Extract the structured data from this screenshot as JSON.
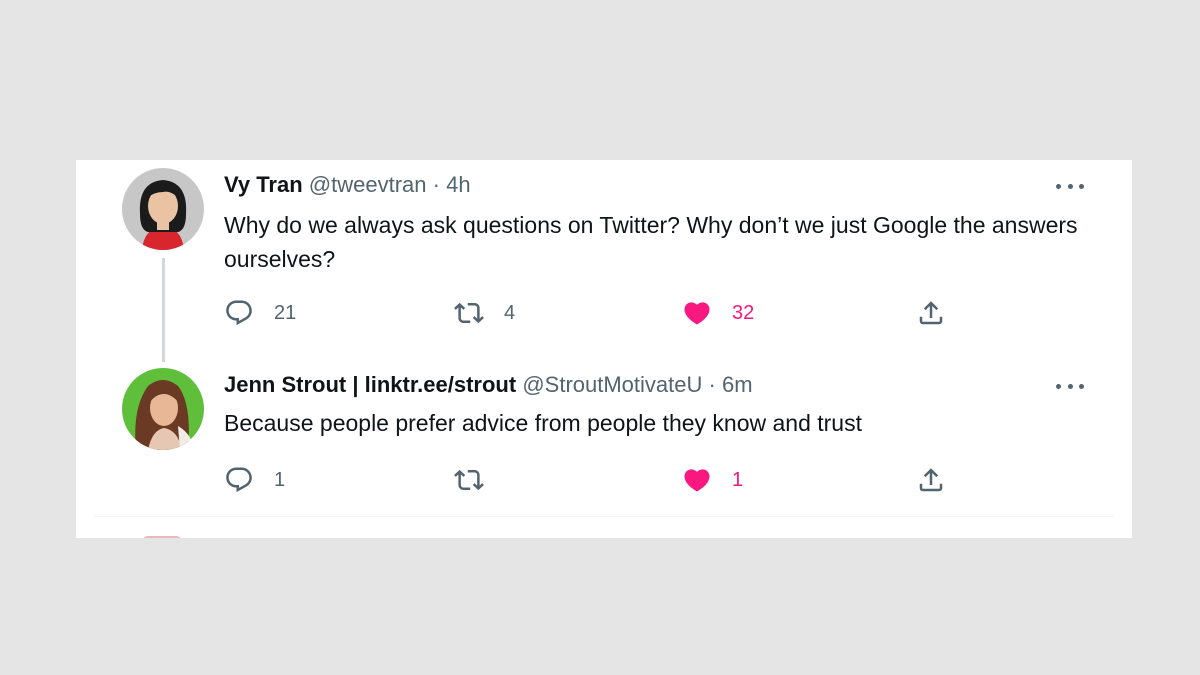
{
  "tweets": [
    {
      "name": "Vy Tran",
      "handle": "@tweevtran",
      "separator": "·",
      "time": "4h",
      "text": "Why do we always ask questions on Twitter? Why don’t we just Google the answers ourselves?",
      "replies": "21",
      "retweets": "4",
      "likes": "32",
      "liked": true,
      "avatar_bg": "#c7c7c7",
      "avatar_shirt": "#d7262e"
    },
    {
      "name": "Jenn Strout | linktr.ee/strout",
      "handle": "@StroutMotivateU",
      "separator": "·",
      "time": "6m",
      "text": "Because people prefer advice from people they know and trust",
      "replies": "1",
      "retweets": "",
      "likes": "1",
      "liked": true,
      "avatar_bg": "#5fbf3a",
      "avatar_hair": "#6b3a24"
    }
  ],
  "icons": {
    "more": "more-horizontal-icon",
    "reply": "reply-icon",
    "retweet": "retweet-icon",
    "like": "heart-filled-icon",
    "share": "share-icon"
  },
  "colors": {
    "like": "#f91880",
    "muted": "#536471",
    "text": "#0f1419",
    "thread_line": "#cfd9de"
  }
}
